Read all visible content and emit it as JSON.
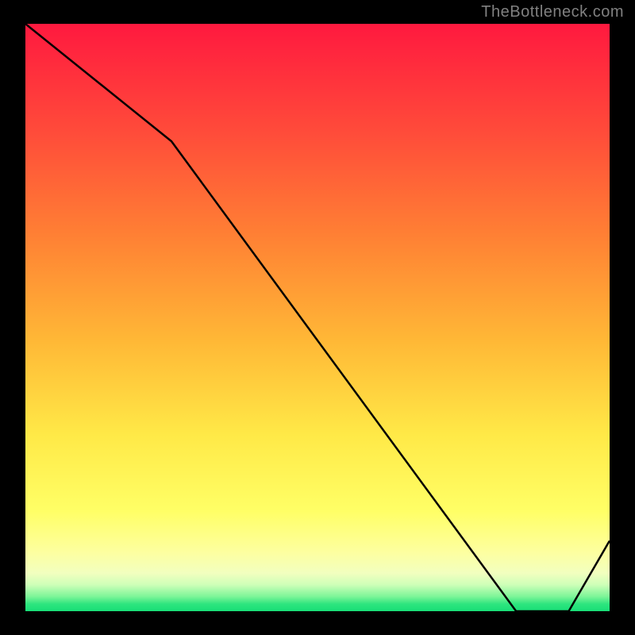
{
  "watermark": "TheBottleneck.com",
  "chart_data": {
    "type": "line",
    "title": "",
    "xlabel": "",
    "ylabel": "",
    "xlim": [
      0,
      100
    ],
    "ylim": [
      0,
      100
    ],
    "x": [
      0,
      25,
      84,
      93,
      100
    ],
    "values": [
      100,
      80,
      0,
      0,
      12
    ],
    "series_name": "bottleneck-curve",
    "optimal_region": {
      "x_start": 84,
      "x_end": 93,
      "label": ""
    },
    "background": "rainbow-vertical-gradient",
    "gradient_stops": [
      {
        "pos": 0.0,
        "color": "#ff193f"
      },
      {
        "pos": 0.18,
        "color": "#ff4a3a"
      },
      {
        "pos": 0.36,
        "color": "#ff8034"
      },
      {
        "pos": 0.54,
        "color": "#ffb836"
      },
      {
        "pos": 0.7,
        "color": "#ffe947"
      },
      {
        "pos": 0.83,
        "color": "#ffff66"
      },
      {
        "pos": 0.9,
        "color": "#fdffa0"
      },
      {
        "pos": 0.935,
        "color": "#f2ffbf"
      },
      {
        "pos": 0.955,
        "color": "#ceffb8"
      },
      {
        "pos": 0.975,
        "color": "#7df598"
      },
      {
        "pos": 0.988,
        "color": "#2de57e"
      },
      {
        "pos": 1.0,
        "color": "#18df77"
      }
    ]
  }
}
